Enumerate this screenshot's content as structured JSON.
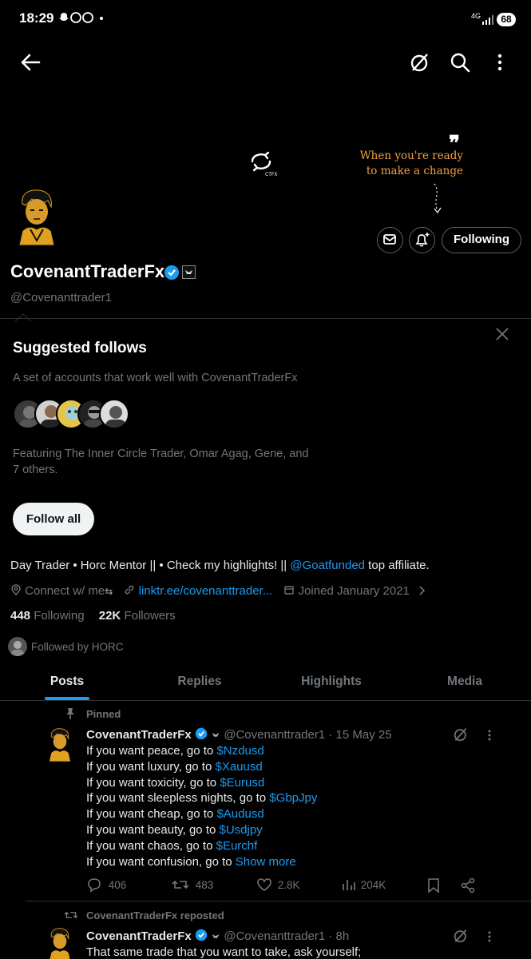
{
  "status_bar": {
    "time": "18:29",
    "notif_icons": [
      "snapchat-icon",
      "whatsapp-icon",
      "whatsapp-icon",
      "dot"
    ],
    "network": "4G",
    "battery": "68"
  },
  "header": {
    "back_icon": "arrow-left-icon",
    "grok_icon": "grok-icon",
    "search_icon": "search-icon",
    "more_icon": "more-vertical-icon"
  },
  "banner": {
    "logo_text": "CTFX",
    "quote_line1": "When you're ready",
    "quote_line2": "to make a change"
  },
  "profile": {
    "name": "CovenantTraderFx",
    "handle": "@Covenanttrader1",
    "following_button": "Following",
    "bio_prefix": "Day Trader • Horc Mentor || • Check my highlights! || ",
    "bio_mention": "@Goatfunded",
    "bio_suffix": " top affiliate.",
    "location": "Connect w/ me",
    "website": "linktr.ee/covenanttrader...",
    "joined": "Joined January 2021",
    "following_count": "448",
    "following_label": "Following",
    "followers_count": "22K",
    "followers_label": "Followers",
    "followed_by": "Followed by HORC"
  },
  "suggested": {
    "title": "Suggested follows",
    "description": "A set of accounts that work well with CovenantTraderFx",
    "featuring": "Featuring The Inner Circle Trader, Omar Agag, Gene, and 7 others.",
    "follow_all": "Follow all"
  },
  "tabs": [
    "Posts",
    "Replies",
    "Highlights",
    "Media"
  ],
  "active_tab": "Posts",
  "posts": [
    {
      "context": "Pinned",
      "name": "CovenantTraderFx",
      "meta": "@Covenanttrader1 · 15 May 25",
      "lines": [
        {
          "text": "If you want peace, go to ",
          "tag": "$Nzdusd"
        },
        {
          "text": "If you want luxury, go to ",
          "tag": "$Xauusd"
        },
        {
          "text": "If you want toxicity, go to ",
          "tag": "$Eurusd"
        },
        {
          "text": "If you want sleepless nights, go to ",
          "tag": "$GbpJpy"
        },
        {
          "text": "If you want cheap, go to ",
          "tag": "$Audusd"
        },
        {
          "text": "If you want beauty, go to ",
          "tag": "$Usdjpy"
        },
        {
          "text": "If you want chaos, go to ",
          "tag": "$Eurchf"
        },
        {
          "text": "If you want confusion, go to ",
          "tag": "Show more"
        }
      ],
      "replies": "406",
      "reposts": "483",
      "likes": "2.8K",
      "views": "204K"
    },
    {
      "context": "CovenantTraderFx reposted",
      "name": "CovenantTraderFx",
      "meta": "@Covenanttrader1 · 8h",
      "first_line": "That same trade that you want to take, ask yourself;"
    }
  ],
  "colors": {
    "background": "#000000",
    "accent": "#1d9bf0",
    "muted": "#71767b",
    "banner_quote": "#f0a040"
  }
}
